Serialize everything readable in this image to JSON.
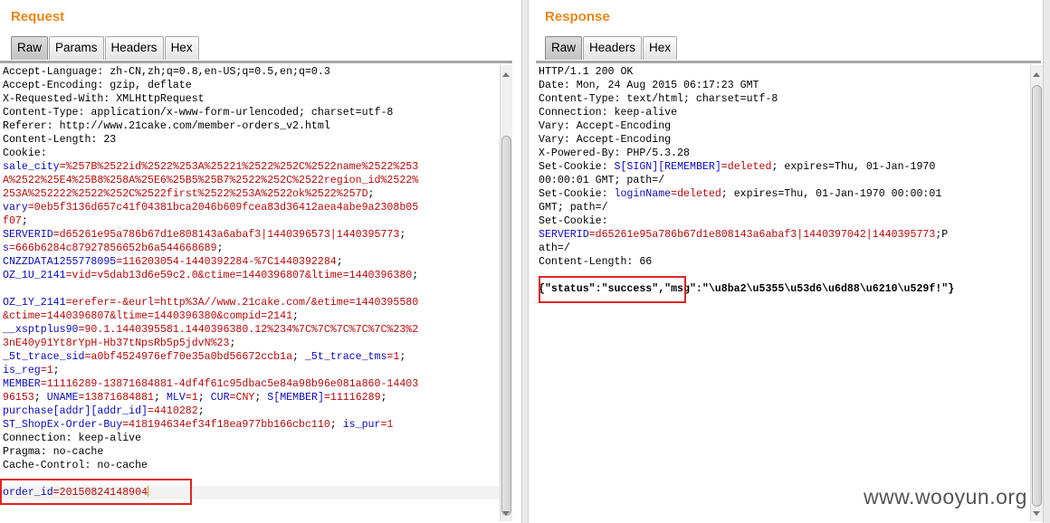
{
  "request": {
    "title": "Request",
    "tabs": [
      "Raw",
      "Params",
      "Headers",
      "Hex"
    ],
    "active_tab": "Raw",
    "lines": [
      {
        "segments": [
          {
            "t": "Accept-Language: zh-CN,zh;q=0.8,en-US;q=0.5,en;q=0.3",
            "c": ""
          }
        ]
      },
      {
        "segments": [
          {
            "t": "Accept-Encoding: gzip, deflate",
            "c": ""
          }
        ]
      },
      {
        "segments": [
          {
            "t": "X-Requested-With: XMLHttpRequest",
            "c": ""
          }
        ]
      },
      {
        "segments": [
          {
            "t": "Content-Type: application/x-www-form-urlencoded; charset=utf-8",
            "c": ""
          }
        ]
      },
      {
        "segments": [
          {
            "t": "Referer: http://www.21cake.com/member-orders_v2.html",
            "c": ""
          }
        ]
      },
      {
        "segments": [
          {
            "t": "Content-Length: 23",
            "c": ""
          }
        ]
      },
      {
        "segments": [
          {
            "t": "Cookie:",
            "c": ""
          }
        ]
      },
      {
        "segments": [
          {
            "t": "sale_city",
            "c": "k"
          },
          {
            "t": "=%257B%2522id%2522%253A%25221%2522%252C%2522name%2522%253",
            "c": "v"
          }
        ]
      },
      {
        "segments": [
          {
            "t": "A%2522%25E4%25B8%258A%25E6%25B5%25B7%2522%252C%2522region_id%2522%",
            "c": "v"
          }
        ]
      },
      {
        "segments": [
          {
            "t": "253A%252222%2522%252C%2522first%2522%253A%2522ok%2522%257D",
            "c": "v"
          },
          {
            "t": ";",
            "c": ""
          }
        ]
      },
      {
        "segments": [
          {
            "t": "vary",
            "c": "k"
          },
          {
            "t": "=0eb5f3136d657c41f04381bca2046b609fcea83d36412aea4abe9a2308b05",
            "c": "v"
          }
        ]
      },
      {
        "segments": [
          {
            "t": "f07",
            "c": "v"
          },
          {
            "t": ";",
            "c": ""
          }
        ]
      },
      {
        "segments": [
          {
            "t": "SERVERID",
            "c": "k"
          },
          {
            "t": "=d65261e95a786b67d1e808143a6abaf3|1440396573|1440395773",
            "c": "v"
          },
          {
            "t": ";",
            "c": ""
          }
        ]
      },
      {
        "segments": [
          {
            "t": "s",
            "c": "k"
          },
          {
            "t": "=666b6284c87927856652b6a544668689",
            "c": "v"
          },
          {
            "t": ";",
            "c": ""
          }
        ]
      },
      {
        "segments": [
          {
            "t": "CNZZDATA1255778095",
            "c": "k"
          },
          {
            "t": "=116203054-1440392284-%7C1440392284",
            "c": "v"
          },
          {
            "t": ";",
            "c": ""
          }
        ]
      },
      {
        "segments": [
          {
            "t": "OZ_1U_2141",
            "c": "k"
          },
          {
            "t": "=vid=v5dab13d6e59c2.0&ctime=1440396807&ltime=1440396380",
            "c": "v"
          },
          {
            "t": ";",
            "c": ""
          }
        ]
      },
      {
        "segments": [
          {
            "t": "",
            "c": ""
          }
        ]
      },
      {
        "segments": [
          {
            "t": "OZ_1Y_2141",
            "c": "k"
          },
          {
            "t": "=erefer=-&eurl=http%3A//www.21cake.com/&etime=1440395580",
            "c": "v"
          }
        ]
      },
      {
        "segments": [
          {
            "t": "&ctime=1440396807&ltime=1440396380&compid=2141",
            "c": "v"
          },
          {
            "t": ";",
            "c": ""
          }
        ]
      },
      {
        "segments": [
          {
            "t": "__xsptplus90",
            "c": "k"
          },
          {
            "t": "=90.1.1440395581.1440396380.12%234%7C%7C%7C%7C%7C%23%2",
            "c": "v"
          }
        ]
      },
      {
        "segments": [
          {
            "t": "3nE40y91Yt8rYpH-Hb37tNpsRb5p5jdvN%23",
            "c": "v"
          },
          {
            "t": ";",
            "c": ""
          }
        ]
      },
      {
        "segments": [
          {
            "t": "_5t_trace_sid",
            "c": "k"
          },
          {
            "t": "=a0bf4524976ef70e35a0bd56672ccb1a",
            "c": "v"
          },
          {
            "t": "; ",
            "c": ""
          },
          {
            "t": "_5t_trace_tms",
            "c": "k"
          },
          {
            "t": "=1",
            "c": "v"
          },
          {
            "t": ";",
            "c": ""
          }
        ]
      },
      {
        "segments": [
          {
            "t": "is_reg",
            "c": "k"
          },
          {
            "t": "=1",
            "c": "v"
          },
          {
            "t": ";",
            "c": ""
          }
        ]
      },
      {
        "segments": [
          {
            "t": "MEMBER",
            "c": "k"
          },
          {
            "t": "=11116289-13871684881-4df4f61c95dbac5e84a98b96e081a860-14403",
            "c": "v"
          }
        ]
      },
      {
        "segments": [
          {
            "t": "96153",
            "c": "v"
          },
          {
            "t": "; ",
            "c": ""
          },
          {
            "t": "UNAME",
            "c": "k"
          },
          {
            "t": "=13871684881",
            "c": "v"
          },
          {
            "t": "; ",
            "c": ""
          },
          {
            "t": "MLV",
            "c": "k"
          },
          {
            "t": "=1",
            "c": "v"
          },
          {
            "t": "; ",
            "c": ""
          },
          {
            "t": "CUR",
            "c": "k"
          },
          {
            "t": "=CNY",
            "c": "v"
          },
          {
            "t": "; ",
            "c": ""
          },
          {
            "t": "S[MEMBER]",
            "c": "k"
          },
          {
            "t": "=11116289",
            "c": "v"
          },
          {
            "t": ";",
            "c": ""
          }
        ]
      },
      {
        "segments": [
          {
            "t": "purchase[addr][addr_id]",
            "c": "k"
          },
          {
            "t": "=4410282",
            "c": "v"
          },
          {
            "t": ";",
            "c": ""
          }
        ]
      },
      {
        "segments": [
          {
            "t": "ST_ShopEx-Order-Buy",
            "c": "k"
          },
          {
            "t": "=418194634ef34f18ea977bb166cbc110",
            "c": "v"
          },
          {
            "t": "; ",
            "c": ""
          },
          {
            "t": "is_pur",
            "c": "k"
          },
          {
            "t": "=1",
            "c": "v"
          }
        ]
      },
      {
        "segments": [
          {
            "t": "Connection: keep-alive",
            "c": ""
          }
        ]
      },
      {
        "segments": [
          {
            "t": "Pragma: no-cache",
            "c": ""
          }
        ]
      },
      {
        "segments": [
          {
            "t": "Cache-Control: no-cache",
            "c": ""
          }
        ]
      },
      {
        "segments": [
          {
            "t": "",
            "c": ""
          }
        ]
      },
      {
        "segments": [
          {
            "t": "order_id",
            "c": "k"
          },
          {
            "t": "=20150824148904",
            "c": "v"
          }
        ],
        "highlight": true,
        "caret": true
      }
    ]
  },
  "response": {
    "title": "Response",
    "tabs": [
      "Raw",
      "Headers",
      "Hex"
    ],
    "active_tab": "Raw",
    "lines": [
      {
        "segments": [
          {
            "t": "HTTP/1.1 200 OK",
            "c": ""
          }
        ]
      },
      {
        "segments": [
          {
            "t": "Date: Mon, 24 Aug 2015 06:17:23 GMT",
            "c": ""
          }
        ]
      },
      {
        "segments": [
          {
            "t": "Content-Type: text/html; charset=utf-8",
            "c": ""
          }
        ]
      },
      {
        "segments": [
          {
            "t": "Connection: keep-alive",
            "c": ""
          }
        ]
      },
      {
        "segments": [
          {
            "t": "Vary: Accept-Encoding",
            "c": ""
          }
        ]
      },
      {
        "segments": [
          {
            "t": "Vary: Accept-Encoding",
            "c": ""
          }
        ]
      },
      {
        "segments": [
          {
            "t": "X-Powered-By: PHP/5.3.28",
            "c": ""
          }
        ]
      },
      {
        "segments": [
          {
            "t": "Set-Cookie: ",
            "c": ""
          },
          {
            "t": "S[SIGN][REMEMBER]",
            "c": "k"
          },
          {
            "t": "=deleted",
            "c": "v"
          },
          {
            "t": "; expires=Thu, 01-Jan-1970",
            "c": ""
          }
        ]
      },
      {
        "segments": [
          {
            "t": "00:00:01 GMT; path=/",
            "c": ""
          }
        ]
      },
      {
        "segments": [
          {
            "t": "Set-Cookie: ",
            "c": ""
          },
          {
            "t": "loginName",
            "c": "k"
          },
          {
            "t": "=deleted",
            "c": "v"
          },
          {
            "t": "; expires=Thu, 01-Jan-1970 00:00:01",
            "c": ""
          }
        ]
      },
      {
        "segments": [
          {
            "t": "GMT; path=/",
            "c": ""
          }
        ]
      },
      {
        "segments": [
          {
            "t": "Set-Cookie:",
            "c": ""
          }
        ]
      },
      {
        "segments": [
          {
            "t": "SERVERID",
            "c": "k"
          },
          {
            "t": "=d65261e95a786b67d1e808143a6abaf3|1440397042|1440395773",
            "c": "v"
          },
          {
            "t": ";P",
            "c": ""
          }
        ]
      },
      {
        "segments": [
          {
            "t": "ath=/",
            "c": ""
          }
        ]
      },
      {
        "segments": [
          {
            "t": "Content-Length: 66",
            "c": ""
          }
        ]
      },
      {
        "segments": [
          {
            "t": "",
            "c": ""
          }
        ]
      }
    ],
    "json_body": "{\"status\":\"success\",\"msg\":\"\\u8ba2\\u5355\\u53d6\\u6d88\\u6210\\u529f!\"}"
  },
  "watermark": "www.wooyun.org",
  "colors": {
    "title": "#e8861a",
    "key": "#0b0bb8",
    "value": "#b60a0a",
    "annotation": "#e02424"
  }
}
